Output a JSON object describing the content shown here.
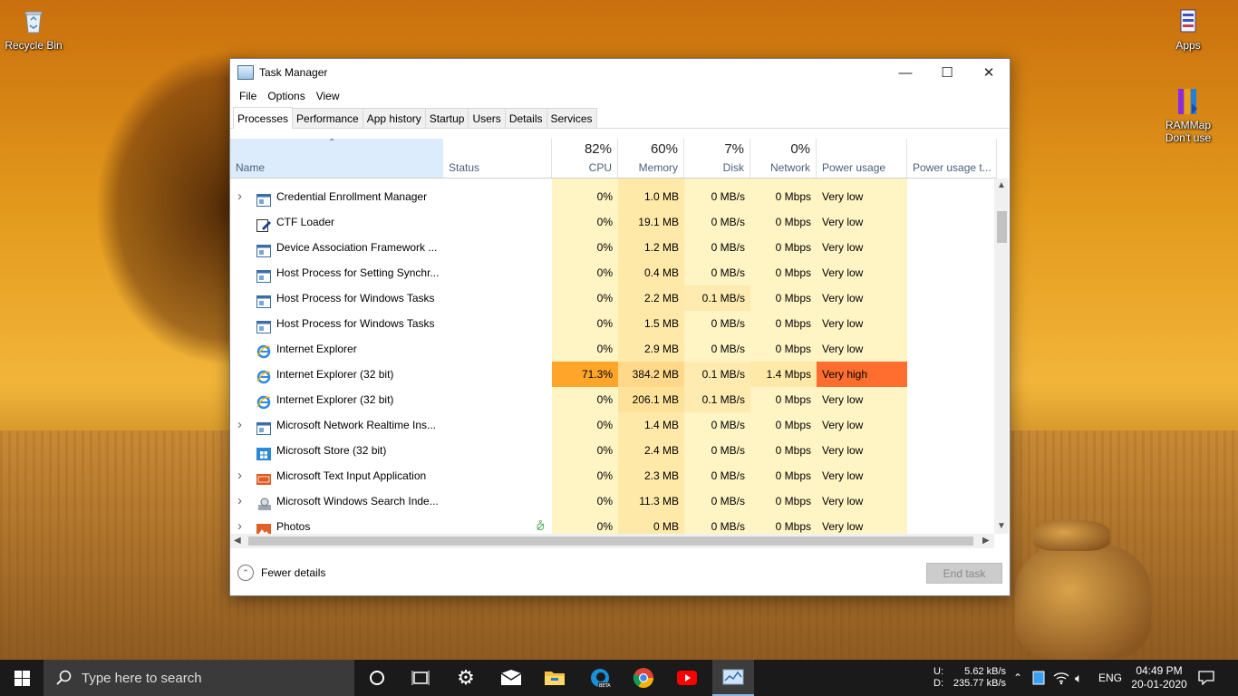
{
  "desktop": {
    "icons": [
      {
        "label": "Recycle Bin"
      },
      {
        "label": "Apps"
      },
      {
        "label": "RAMMap Don't use"
      }
    ]
  },
  "window": {
    "title": "Task Manager",
    "controls": {
      "minimize": "—",
      "maximize": "☐",
      "close": "✕"
    }
  },
  "menu": [
    "File",
    "Options",
    "View"
  ],
  "tabs": [
    "Processes",
    "Performance",
    "App history",
    "Startup",
    "Users",
    "Details",
    "Services"
  ],
  "active_tab": "Processes",
  "columns": {
    "name": "Name",
    "status": "Status",
    "cpu": {
      "label": "CPU",
      "pct": "82%"
    },
    "memory": {
      "label": "Memory",
      "pct": "60%"
    },
    "disk": {
      "label": "Disk",
      "pct": "7%"
    },
    "network": {
      "label": "Network",
      "pct": "0%"
    },
    "power": "Power usage",
    "power_trend": "Power usage t..."
  },
  "rows": [
    {
      "name": "Credential Enrollment Manager",
      "expand": true,
      "icon": "window-app-icon",
      "status": "",
      "cpu": "0%",
      "memory": "1.0 MB",
      "disk": "0 MB/s",
      "network": "0 Mbps",
      "power": "Very low"
    },
    {
      "name": "CTF Loader",
      "expand": false,
      "icon": "pen-edit-icon",
      "status": "",
      "cpu": "0%",
      "memory": "19.1 MB",
      "disk": "0 MB/s",
      "network": "0 Mbps",
      "power": "Very low"
    },
    {
      "name": "Device Association Framework ...",
      "expand": false,
      "icon": "window-app-icon",
      "status": "",
      "cpu": "0%",
      "memory": "1.2 MB",
      "disk": "0 MB/s",
      "network": "0 Mbps",
      "power": "Very low"
    },
    {
      "name": "Host Process for Setting Synchr...",
      "expand": false,
      "icon": "window-app-icon",
      "status": "",
      "cpu": "0%",
      "memory": "0.4 MB",
      "disk": "0 MB/s",
      "network": "0 Mbps",
      "power": "Very low"
    },
    {
      "name": "Host Process for Windows Tasks",
      "expand": false,
      "icon": "window-app-icon",
      "status": "",
      "cpu": "0%",
      "memory": "2.2 MB",
      "disk": "0.1 MB/s",
      "network": "0 Mbps",
      "power": "Very low"
    },
    {
      "name": "Host Process for Windows Tasks",
      "expand": false,
      "icon": "window-app-icon",
      "status": "",
      "cpu": "0%",
      "memory": "1.5 MB",
      "disk": "0 MB/s",
      "network": "0 Mbps",
      "power": "Very low"
    },
    {
      "name": "Internet Explorer",
      "expand": false,
      "icon": "internet-explorer-icon",
      "status": "",
      "cpu": "0%",
      "memory": "2.9 MB",
      "disk": "0 MB/s",
      "network": "0 Mbps",
      "power": "Very low"
    },
    {
      "name": "Internet Explorer (32 bit)",
      "expand": false,
      "icon": "internet-explorer-icon",
      "status": "",
      "cpu": "71.3%",
      "memory": "384.2 MB",
      "disk": "0.1 MB/s",
      "network": "1.4 Mbps",
      "power": "Very high",
      "hot": true
    },
    {
      "name": "Internet Explorer (32 bit)",
      "expand": false,
      "icon": "internet-explorer-icon",
      "status": "",
      "cpu": "0%",
      "memory": "206.1 MB",
      "disk": "0.1 MB/s",
      "network": "0 Mbps",
      "power": "Very low",
      "memwarm": true
    },
    {
      "name": "Microsoft Network Realtime Ins...",
      "expand": true,
      "icon": "window-app-icon",
      "status": "",
      "cpu": "0%",
      "memory": "1.4 MB",
      "disk": "0 MB/s",
      "network": "0 Mbps",
      "power": "Very low"
    },
    {
      "name": "Microsoft Store (32 bit)",
      "expand": false,
      "icon": "store-icon",
      "status": "",
      "cpu": "0%",
      "memory": "2.4 MB",
      "disk": "0 MB/s",
      "network": "0 Mbps",
      "power": "Very low"
    },
    {
      "name": "Microsoft Text Input Application",
      "expand": true,
      "icon": "keyboard-icon",
      "status": "",
      "cpu": "0%",
      "memory": "2.3 MB",
      "disk": "0 MB/s",
      "network": "0 Mbps",
      "power": "Very low"
    },
    {
      "name": "Microsoft Windows Search Inde...",
      "expand": true,
      "icon": "search-indexer-icon",
      "status": "",
      "cpu": "0%",
      "memory": "11.3 MB",
      "disk": "0 MB/s",
      "network": "0 Mbps",
      "power": "Very low"
    },
    {
      "name": "Photos",
      "expand": true,
      "icon": "photos-icon",
      "status": "",
      "cpu": "0%",
      "memory": "0 MB",
      "disk": "0 MB/s",
      "network": "0 Mbps",
      "power": "Very low",
      "suspended": true
    }
  ],
  "footer": {
    "fewer_details": "Fewer details",
    "end_task": "End task"
  },
  "taskbar": {
    "search_placeholder": "Type here to search",
    "net_up_label": "U:",
    "net_up": "5.62 kB/s",
    "net_down_label": "D:",
    "net_down": "235.77 kB/s",
    "lang": "ENG",
    "time": "04:49 PM",
    "date": "20-01-2020"
  },
  "colors": {
    "cpu_bg": "#fff4c4",
    "mem_bg": "#ffe9a8",
    "hot_cpu": "#ffa52a",
    "hot_power": "#ff6e2e",
    "header_sel": "#dcecfc"
  }
}
